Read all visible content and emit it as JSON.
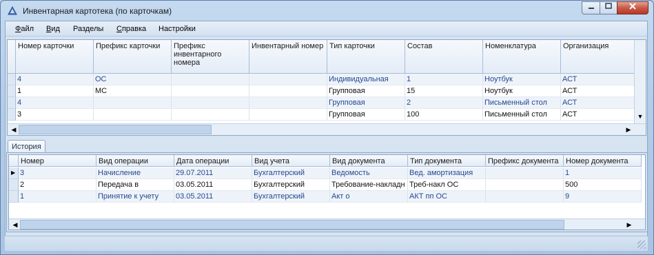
{
  "window": {
    "title": "Инвентарная картотека (по карточкам)"
  },
  "menu": [
    {
      "label": "Файл",
      "u": "Ф",
      "rest": "айл"
    },
    {
      "label": "Вид",
      "u": "В",
      "rest": "ид"
    },
    {
      "label": "Разделы",
      "u": "",
      "rest": "Разделы"
    },
    {
      "label": "Справка",
      "u": "С",
      "rest": "правка"
    },
    {
      "label": "Настройки",
      "u": "",
      "rest": "Настройки"
    }
  ],
  "cards": {
    "columns": [
      "Номер карточки",
      "Префикс карточки",
      "Префикс инвентарного номера",
      "Инвентарный номер",
      "Тип карточки",
      "Состав",
      "Номенклатура",
      "Организация"
    ],
    "rows": [
      [
        "4",
        "ОС",
        "",
        "",
        "Индивидуальная",
        "1",
        "Ноутбук",
        "АСТ"
      ],
      [
        "1",
        "МС",
        "",
        "",
        "Групповая",
        "15",
        "Ноутбук",
        "АСТ"
      ],
      [
        "4",
        "",
        "",
        "",
        "Групповая",
        "2",
        "Письменный стол",
        "АСТ"
      ],
      [
        "3",
        "",
        "",
        "",
        "Групповая",
        "100",
        "Письменный стол",
        "АСТ"
      ]
    ]
  },
  "history": {
    "tab_label": "История",
    "columns": [
      "Номер",
      "Вид операции",
      "Дата операции",
      "Вид учета",
      "Вид документа",
      "Тип документа",
      "Префикс документа",
      "Номер документа"
    ],
    "rows": [
      [
        "3",
        "Начисление",
        "29.07.2011",
        "Бухгалтерский",
        "Ведомость",
        "Вед. амортизация",
        "",
        "1"
      ],
      [
        "2",
        "Передача в",
        "03.05.2011",
        "Бухгалтерский",
        "Требование-накладн",
        "Треб-накл ОС",
        "",
        "500"
      ],
      [
        "1",
        "Принятие к учету",
        "03.05.2011",
        "Бухгалтерский",
        "Акт о",
        "АКТ пп ОС",
        "",
        "9"
      ]
    ]
  },
  "colors": {
    "accent": "#23488f",
    "header": "#e4ecf6",
    "window": "#b4cde8"
  }
}
